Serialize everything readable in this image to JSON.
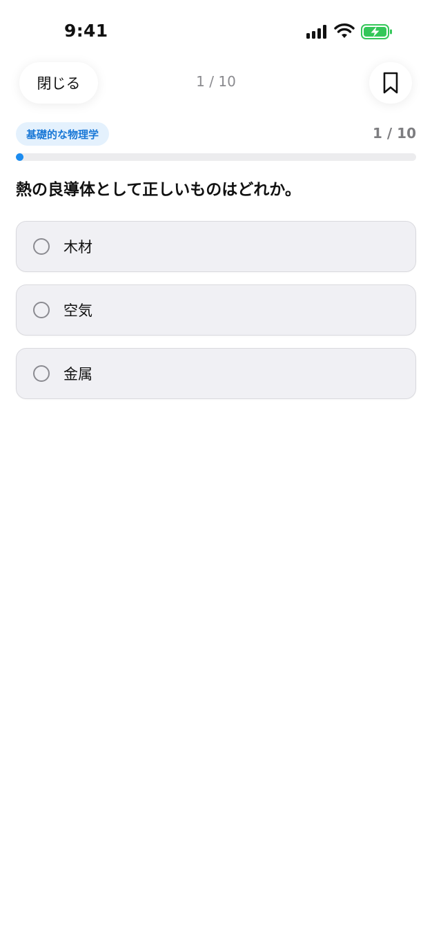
{
  "status_bar": {
    "time": "9:41",
    "icons": [
      "cellular-signal-icon",
      "wifi-icon",
      "battery-charging-icon"
    ],
    "battery_color": "#34c759"
  },
  "header": {
    "close_label": "閉じる",
    "counter": "1 / 10",
    "bookmark_icon": "bookmark-icon"
  },
  "quiz": {
    "category": "基礎的な物理学",
    "progress_label": "1 / 10",
    "progress_fraction": 0.01,
    "question": "熱の良導体として正しいものはどれか。",
    "options": [
      {
        "label": "木材",
        "selected": false
      },
      {
        "label": "空気",
        "selected": false
      },
      {
        "label": "金属",
        "selected": false
      }
    ]
  },
  "colors": {
    "accent": "#1c8cf0",
    "chip_background": "#e4f1fd",
    "chip_text": "#1877d6",
    "option_background": "#f0f0f4"
  }
}
